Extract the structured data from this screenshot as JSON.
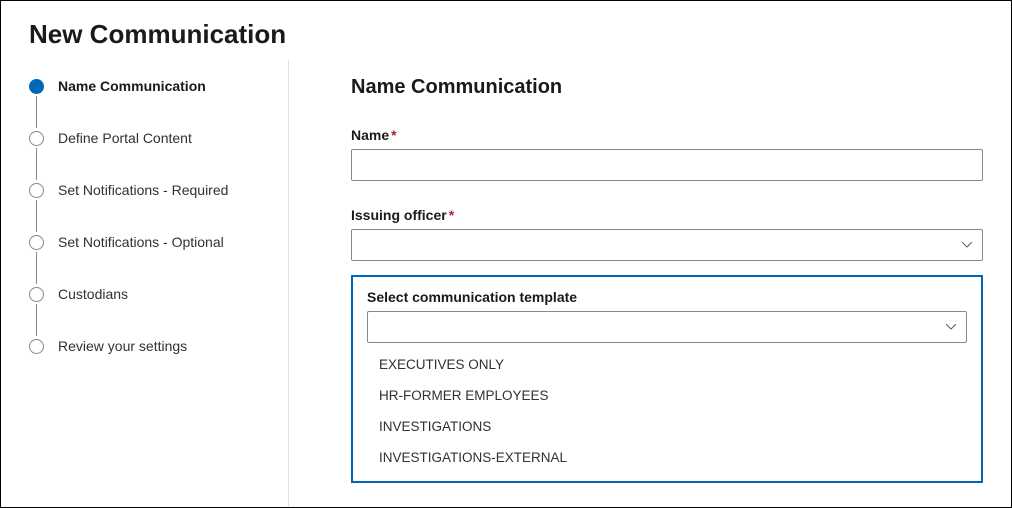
{
  "pageTitle": "New Communication",
  "sectionTitle": "Name Communication",
  "steps": [
    {
      "label": "Name Communication",
      "active": true
    },
    {
      "label": "Define Portal Content",
      "active": false
    },
    {
      "label": "Set Notifications - Required",
      "active": false
    },
    {
      "label": "Set Notifications - Optional",
      "active": false
    },
    {
      "label": "Custodians",
      "active": false
    },
    {
      "label": "Review your settings",
      "active": false
    }
  ],
  "fields": {
    "name": {
      "label": "Name",
      "value": ""
    },
    "issuingOfficer": {
      "label": "Issuing officer",
      "value": ""
    },
    "template": {
      "label": "Select communication template",
      "value": "",
      "options": [
        "EXECUTIVES ONLY",
        "HR-FORMER EMPLOYEES",
        "INVESTIGATIONS",
        "INVESTIGATIONS-EXTERNAL"
      ]
    }
  },
  "required": "*"
}
